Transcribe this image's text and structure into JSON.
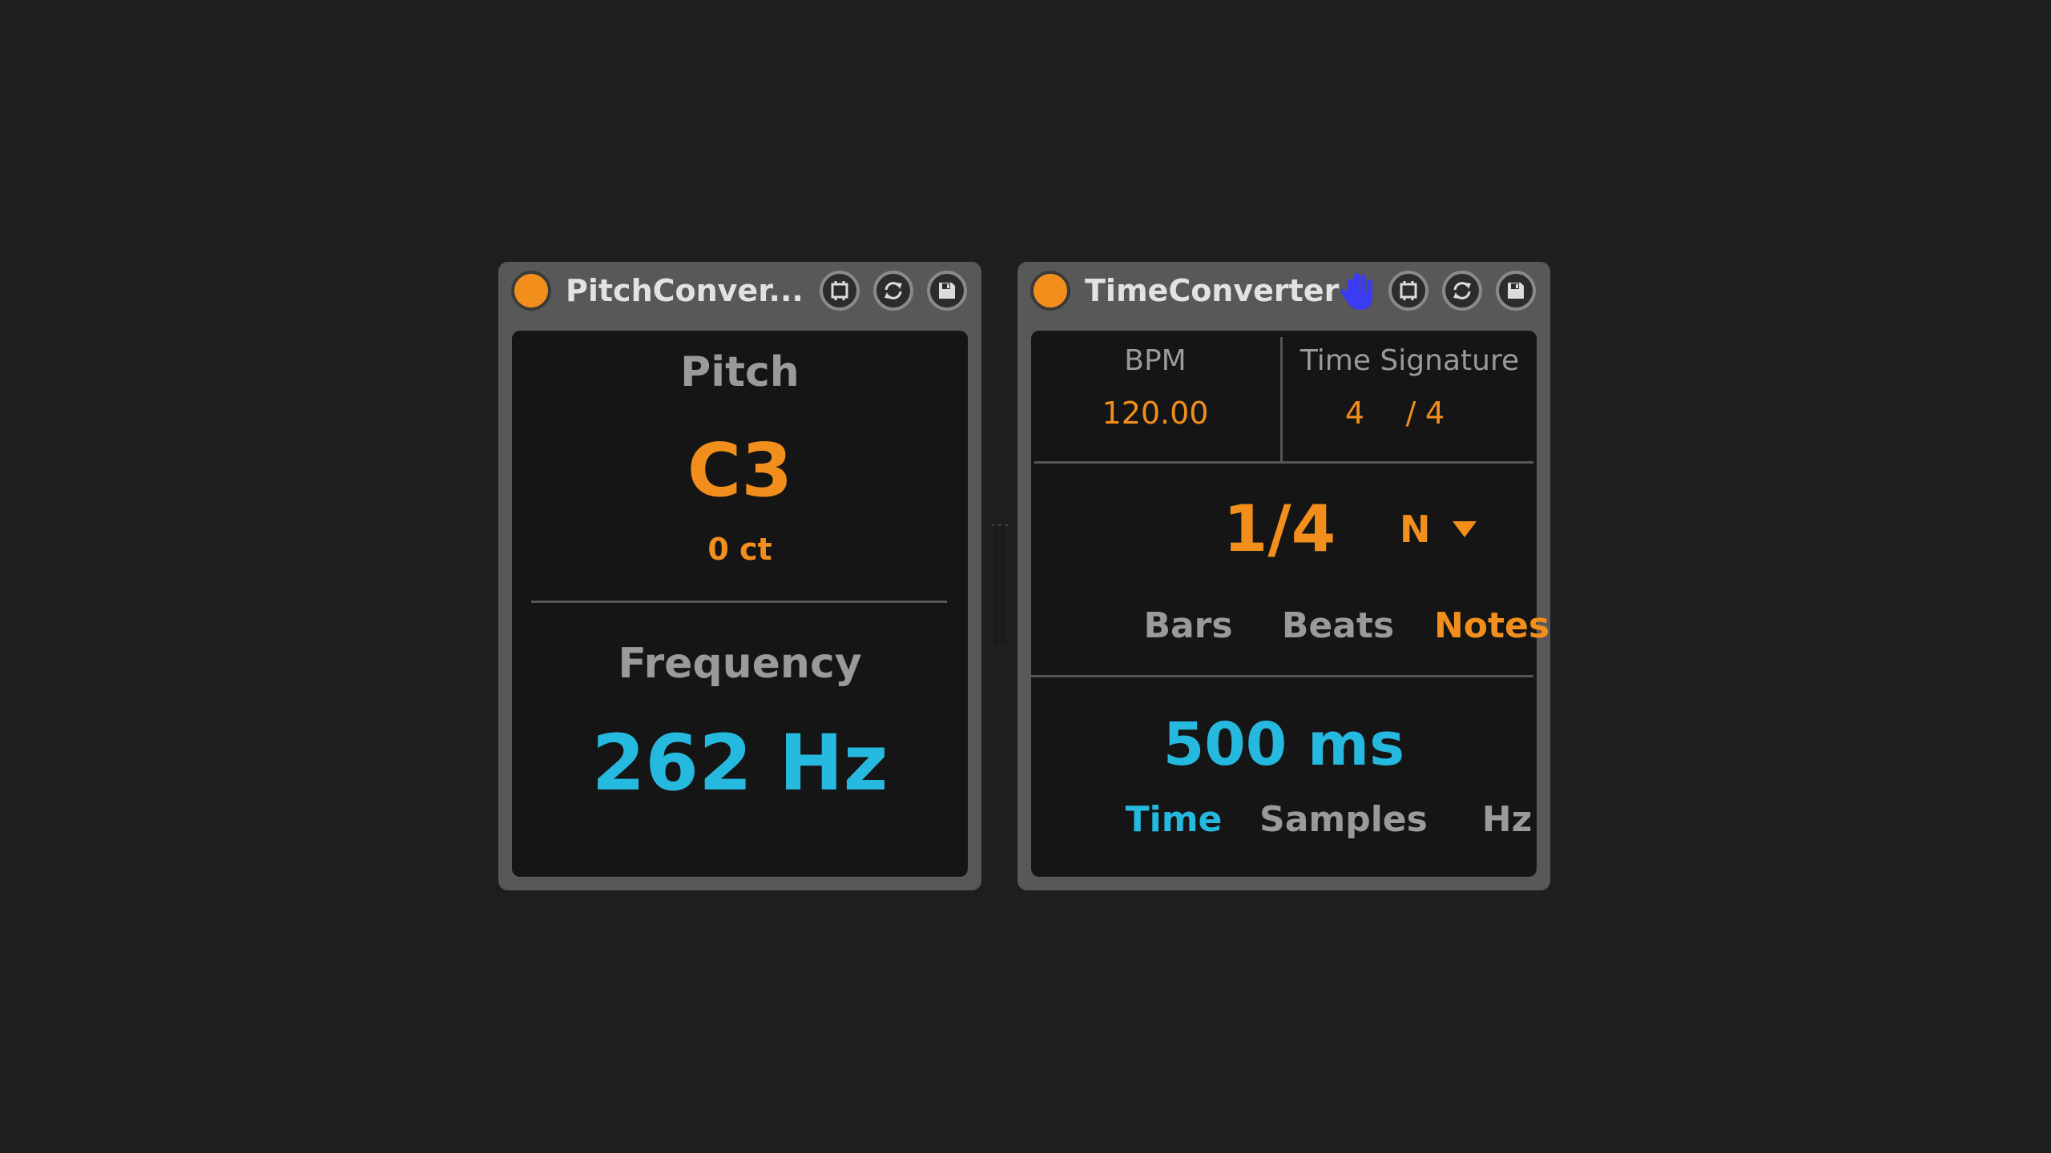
{
  "pitch_device": {
    "title": "PitchConver...",
    "pitch_label": "Pitch",
    "pitch_value": "C3",
    "cents_value": "0 ct",
    "frequency_label": "Frequency",
    "frequency_value": "262 Hz"
  },
  "time_device": {
    "title": "TimeConverter",
    "bpm_label": "BPM",
    "bpm_value": "120.00",
    "time_signature_label": "Time Signature",
    "time_signature_numerator": "4",
    "time_signature_slash": "/",
    "time_signature_denominator": "4",
    "note_value": "1/4",
    "note_mode": "N",
    "mode_tabs": [
      {
        "label": "Bars",
        "active": false
      },
      {
        "label": "Beats",
        "active": false
      },
      {
        "label": "Notes",
        "active": true
      }
    ],
    "output_value": "500 ms",
    "output_tabs": [
      {
        "label": "Time",
        "active": true
      },
      {
        "label": "Samples",
        "active": false
      },
      {
        "label": "Hz",
        "active": false
      }
    ]
  },
  "icons": [
    "power-icon",
    "hotswap-icon",
    "refresh-icon",
    "save-icon",
    "hand-icon",
    "dropdown-arrow-icon"
  ],
  "colors": {
    "background": "#1e1e1e",
    "device_frame": "#585858",
    "panel": "#151515",
    "accent_orange": "#f28f1c",
    "accent_cyan": "#26b9df",
    "label_gray": "#9a9a9a",
    "hand_blue": "#3b3bf2"
  }
}
